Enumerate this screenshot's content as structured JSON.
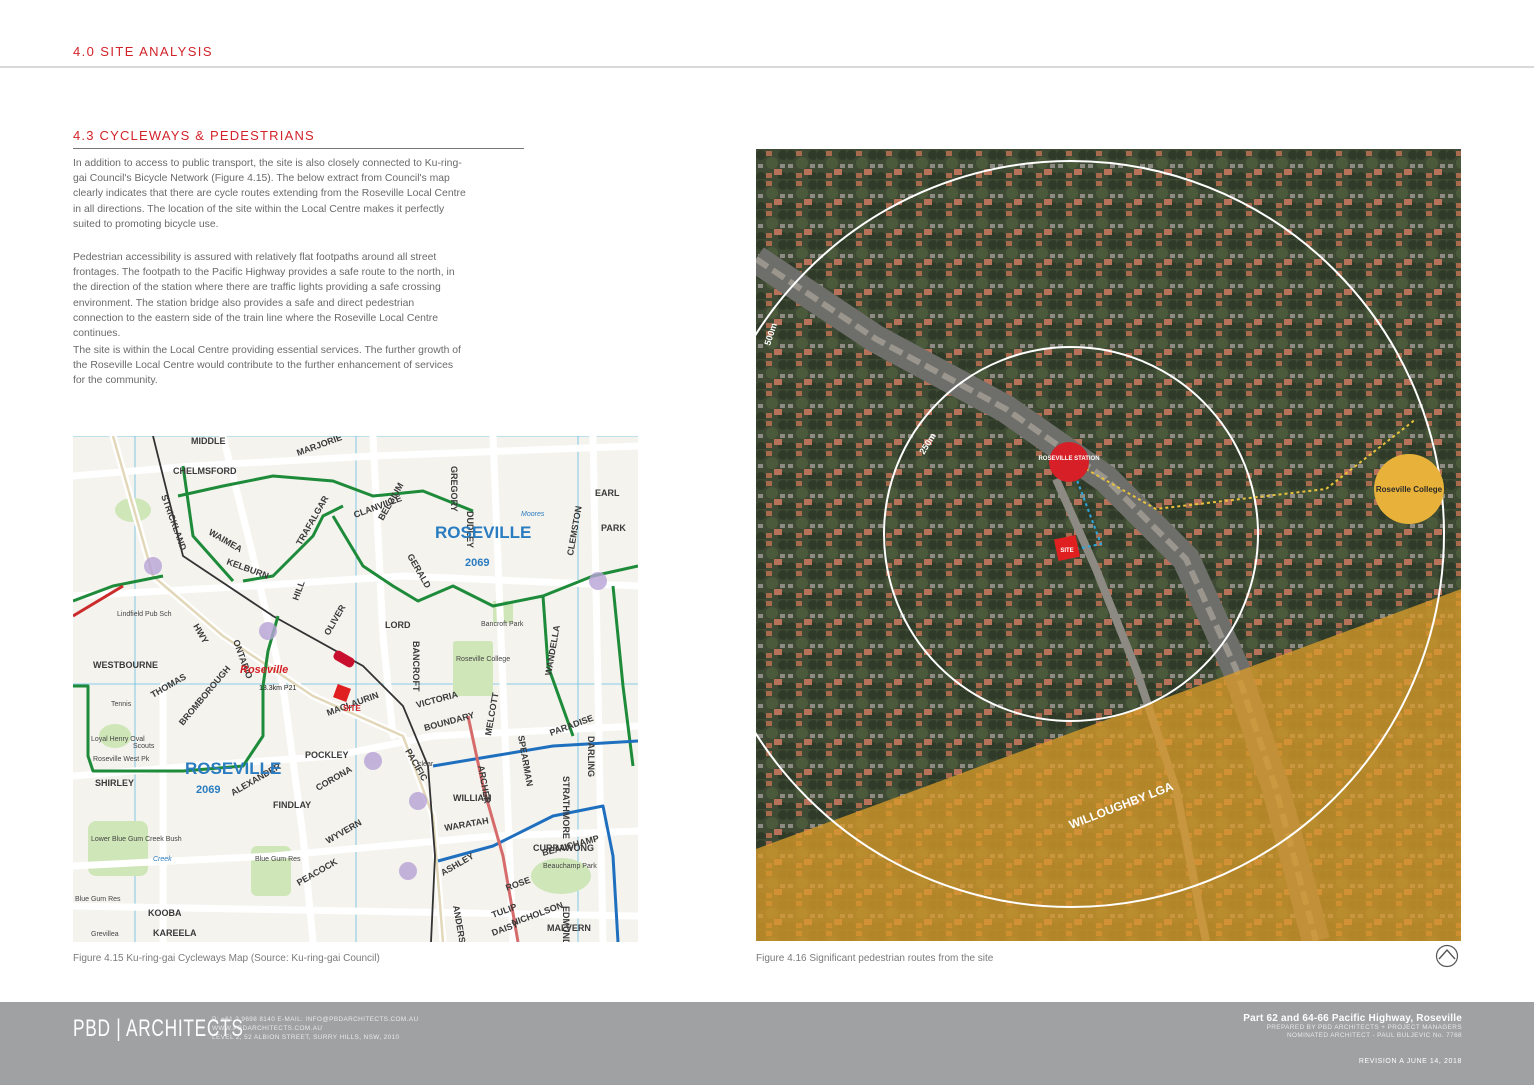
{
  "header": {
    "section_title": "4.0 SITE ANALYSIS"
  },
  "section": {
    "title": "4.3 CYCLEWAYS & PEDESTRIANS",
    "paragraphs": [
      "In addition to access to public transport, the site is also closely connected to Ku-ring-gai Council's Bicycle Network (Figure 4.15). The below extract from Council's map clearly indicates that there are cycle routes extending from the Roseville Local Centre in all directions. The location of the site within the Local Centre makes it perfectly suited to promoting bicycle use.",
      "Pedestrian accessibility is assured with relatively flat footpaths around all street frontages. The footpath to the Pacific Highway provides a safe route to the north, in the direction of the station where there are traffic lights providing a safe crossing environment. The station bridge also provides a safe and direct pedestrian connection to the eastern side of the train line where the Roseville Local Centre continues.",
      "The site is within the Local Centre providing essential services. The further growth of the Roseville Local Centre would contribute to the further enhancement of services for the community."
    ]
  },
  "map": {
    "streets": [
      "MIDDLE",
      "CHELMSFORD",
      "MARJORIE",
      "TRAFALGAR",
      "CLANVILLE",
      "GREGORY",
      "DUDLEY",
      "WAIMEA",
      "KELBURN",
      "BELGIUM",
      "GERALD",
      "HILL",
      "LORD",
      "OLIVER",
      "BANCROFT",
      "VICTORIA",
      "BOUNDARY",
      "PACIFIC",
      "HWY",
      "ONTARIO",
      "WESTBOURNE",
      "THOMAS",
      "BROMBOROUGH",
      "SHIRLEY",
      "ALEXANDER",
      "FINDLAY",
      "CORONA",
      "WYVERN",
      "ARCHER",
      "WARATAH",
      "WILLIAM",
      "ASHLEY",
      "ANDERSON",
      "PEACOCK",
      "KOOBA",
      "KAREELA",
      "STRICKLAND",
      "CLEMSTON",
      "WANDELLA",
      "PARK",
      "EARL",
      "SPEARMAN",
      "MELCOTT",
      "BEAUCHAMP",
      "NICHOLSON",
      "MALVERN",
      "DAISY",
      "TULIP",
      "ROSE",
      "CURRAWONG",
      "PARADISE",
      "STRATHMORE",
      "DARLING",
      "EDMUND",
      "MACLAURIN",
      "POCKLEY"
    ],
    "suburb_labels": [
      {
        "name": "ROSEVILLE",
        "postcode": "2069"
      },
      {
        "name": "ROSEVILLE",
        "postcode": "2069"
      }
    ],
    "places": [
      "Roseville",
      "SITE",
      "Lindfield Pub Sch",
      "Loyal Henry Oval",
      "Roseville West Pk",
      "Tennis",
      "Scouts",
      "Bancroft Park",
      "Roseville College",
      "Lower Blue Gum Creek Bush",
      "Blue Gum Res",
      "Blue Gum Res",
      "Beauchamp Park",
      "Creek",
      "Moores",
      "clear",
      "Grevillea"
    ],
    "grid_ref": "13.3km P21",
    "route_colors": {
      "green": "#1e8b3a",
      "blue": "#1f6fbf",
      "red": "#cc2b2b",
      "rail": "#333333"
    }
  },
  "aerial": {
    "radius_labels": [
      "500m",
      "250m"
    ],
    "station_label": "ROSEVILLE STATION",
    "site_label": "SITE",
    "college_label": "Roseville College",
    "lga_label": "WILLOUGHBY LGA",
    "colors": {
      "lga_overlay": "#d89a2a",
      "station": "#d61f26",
      "college": "#e8b23a"
    }
  },
  "captions": {
    "map": "Figure 4.15 Ku-ring-gai Cycleways Map (Source: Ku-ring-gai Council)",
    "aerial": "Figure 4.16 Significant pedestrian routes from the site"
  },
  "footer": {
    "logo": "PBD | ARCHITECTS",
    "contact": [
      "P: +61 2 9698 8140    E-MAIL: INFO@PBDARCHITECTS.COM.AU",
      "WWW.PBDARCHITECTS.COM.AU",
      "LEVEL 2, 52 ALBION STREET, SURRY HILLS, NSW, 2010"
    ],
    "project": "Part 62 and 64-66 Pacific Highway, Roseville",
    "prepared_by": "PREPARED BY PBD ARCHITECTS + PROJECT MANAGERS",
    "nominated": "NOMINATED ARCHITECT - PAUL BULJEVIC   No. 7768",
    "revision": "REVISION A    JUNE 14, 2018"
  }
}
